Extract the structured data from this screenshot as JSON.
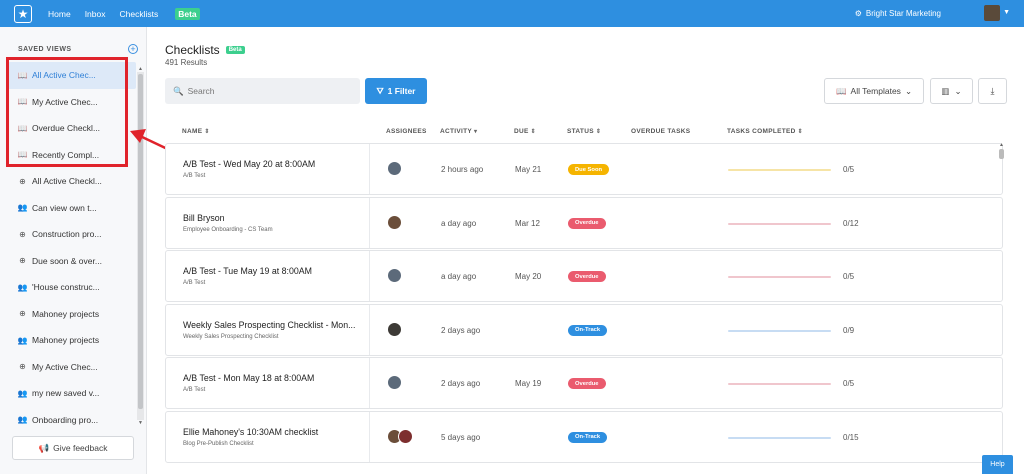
{
  "topbar": {
    "nav": [
      "Home",
      "Inbox",
      "Checklists"
    ],
    "beta": "Beta",
    "org": "Bright Star Marketing"
  },
  "sidebar": {
    "header": "SAVED VIEWS",
    "add_icon": "plus-circle-icon",
    "items": [
      {
        "label": "All Active Chec...",
        "icon": "book-icon",
        "active": true
      },
      {
        "label": "My Active Chec...",
        "icon": "book-icon"
      },
      {
        "label": "Overdue Checkl...",
        "icon": "book-icon"
      },
      {
        "label": "Recently Compl...",
        "icon": "book-icon"
      },
      {
        "label": "All Active Checkl...",
        "icon": "globe-icon"
      },
      {
        "label": "Can view own t...",
        "icon": "users-icon"
      },
      {
        "label": "Construction pro...",
        "icon": "globe-icon"
      },
      {
        "label": "Due soon & over...",
        "icon": "globe-icon"
      },
      {
        "label": "'House construc...",
        "icon": "users-icon"
      },
      {
        "label": "Mahoney projects",
        "icon": "globe-icon"
      },
      {
        "label": "Mahoney projects",
        "icon": "users-icon"
      },
      {
        "label": "My Active Chec...",
        "icon": "globe-icon"
      },
      {
        "label": "my new saved v...",
        "icon": "users-icon"
      },
      {
        "label": "Onboarding pro...",
        "icon": "users-icon"
      }
    ],
    "feedback": "Give feedback"
  },
  "main": {
    "title": "Checklists",
    "beta": "Beta",
    "results": "491 Results",
    "search_placeholder": "Search",
    "filter": "1 Filter",
    "templates": "All Templates",
    "columns": {
      "name": "NAME",
      "assignees": "ASSIGNEES",
      "activity": "ACTIVITY",
      "due": "DUE",
      "status": "STATUS",
      "overdue": "OVERDUE TASKS",
      "completed": "TASKS COMPLETED"
    },
    "rows": [
      {
        "name": "A/B Test - Wed May 20 at 8:00AM",
        "sub": "A/B Test",
        "activity": "2 hours ago",
        "due": "May 21",
        "status": "Due Soon",
        "progress": "0/5",
        "avatars": [
          "a1"
        ]
      },
      {
        "name": "Bill Bryson",
        "sub": "Employee Onboarding - CS Team",
        "activity": "a day ago",
        "due": "Mar 12",
        "status": "Overdue",
        "progress": "0/12",
        "avatars": [
          "a2"
        ]
      },
      {
        "name": "A/B Test - Tue May 19 at 8:00AM",
        "sub": "A/B Test",
        "activity": "a day ago",
        "due": "May 20",
        "status": "Overdue",
        "progress": "0/5",
        "avatars": [
          "a1"
        ]
      },
      {
        "name": "Weekly Sales Prospecting Checklist - Mon...",
        "sub": "Weekly Sales Prospecting Checklist",
        "activity": "2 days ago",
        "due": "",
        "status": "On-Track",
        "progress": "0/9",
        "avatars": [
          "a3"
        ]
      },
      {
        "name": "A/B Test - Mon May 18 at 8:00AM",
        "sub": "A/B Test",
        "activity": "2 days ago",
        "due": "May 19",
        "status": "Overdue",
        "progress": "0/5",
        "avatars": [
          "a1"
        ]
      },
      {
        "name": "Ellie Mahoney's 10:30AM checklist",
        "sub": "Blog Pre-Publish Checklist",
        "activity": "5 days ago",
        "due": "",
        "status": "On-Track",
        "progress": "0/15",
        "avatars": [
          "a2",
          "a4"
        ]
      }
    ]
  },
  "colors": {
    "accent": "#2e8fe0",
    "due_soon": "#f5b400",
    "overdue": "#ea5b6e",
    "on_track": "#2e8fe0",
    "annotation": "#e0232b"
  },
  "help": "Help"
}
